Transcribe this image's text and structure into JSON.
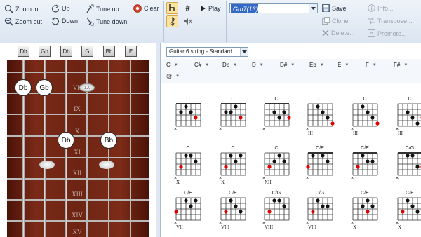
{
  "toolbar": {
    "zoom_in": "Zoom in",
    "zoom_out": "Zoom out",
    "up": "Up",
    "down": "Down",
    "tune_up": "Tune up",
    "tune_down": "Tune down",
    "clear": "Clear",
    "play": "Play",
    "chord_value": "Gm7(13)",
    "save": "Save",
    "clone": "Clone",
    "delete": "Delete...",
    "info": "Info...",
    "transpose": "Transpose...",
    "promote": "Promote..."
  },
  "fretboard": {
    "open_strings": [
      "Db",
      "Gb",
      "Db",
      "G",
      "Bb",
      "E"
    ],
    "fret_numerals": [
      "VII",
      "IX",
      "X",
      "XI",
      "XII",
      "XIII",
      "XIV",
      "XV"
    ],
    "notes": [
      {
        "label": "Db",
        "string": 0,
        "fret": 9
      },
      {
        "label": "Gb",
        "string": 1,
        "fret": 9
      },
      {
        "label": "1X",
        "string": 3,
        "fret": 9,
        "muted": true
      },
      {
        "label": "Db",
        "string": 2,
        "fret": 11
      },
      {
        "label": "Bb",
        "string": 4,
        "fret": 11
      }
    ]
  },
  "chord_panel": {
    "tuning": "Guitar 6 string - Standard",
    "notes_row1": [
      "C",
      "C#",
      "Db",
      "D",
      "D#",
      "Eb",
      "E",
      "F",
      "F#"
    ],
    "notes_row2": [
      "@"
    ],
    "chords": [
      {
        "name": "C",
        "pos": ""
      },
      {
        "name": "C",
        "pos": ""
      },
      {
        "name": "C",
        "pos": ""
      },
      {
        "name": "C",
        "pos": "III"
      },
      {
        "name": "C",
        "pos": "III"
      },
      {
        "name": "C",
        "pos": "III"
      },
      {
        "name": "C",
        "pos": "X"
      },
      {
        "name": "C",
        "pos": "X"
      },
      {
        "name": "C",
        "pos": "XII"
      },
      {
        "name": "C/E",
        "pos": ""
      },
      {
        "name": "C/E",
        "pos": ""
      },
      {
        "name": "C/G",
        "pos": ""
      },
      {
        "name": "C/E",
        "pos": "VII"
      },
      {
        "name": "C/E",
        "pos": "VIII"
      },
      {
        "name": "C/G",
        "pos": "VIII"
      },
      {
        "name": "C/G",
        "pos": "VIII"
      },
      {
        "name": "C/E",
        "pos": "X"
      },
      {
        "name": "C/E",
        "pos": "X"
      }
    ]
  },
  "colors": {
    "accent": "#3369c6",
    "toolbar_bg": "#dbe5f1",
    "neck": "#6e2413",
    "root_dot": "#e00000"
  }
}
